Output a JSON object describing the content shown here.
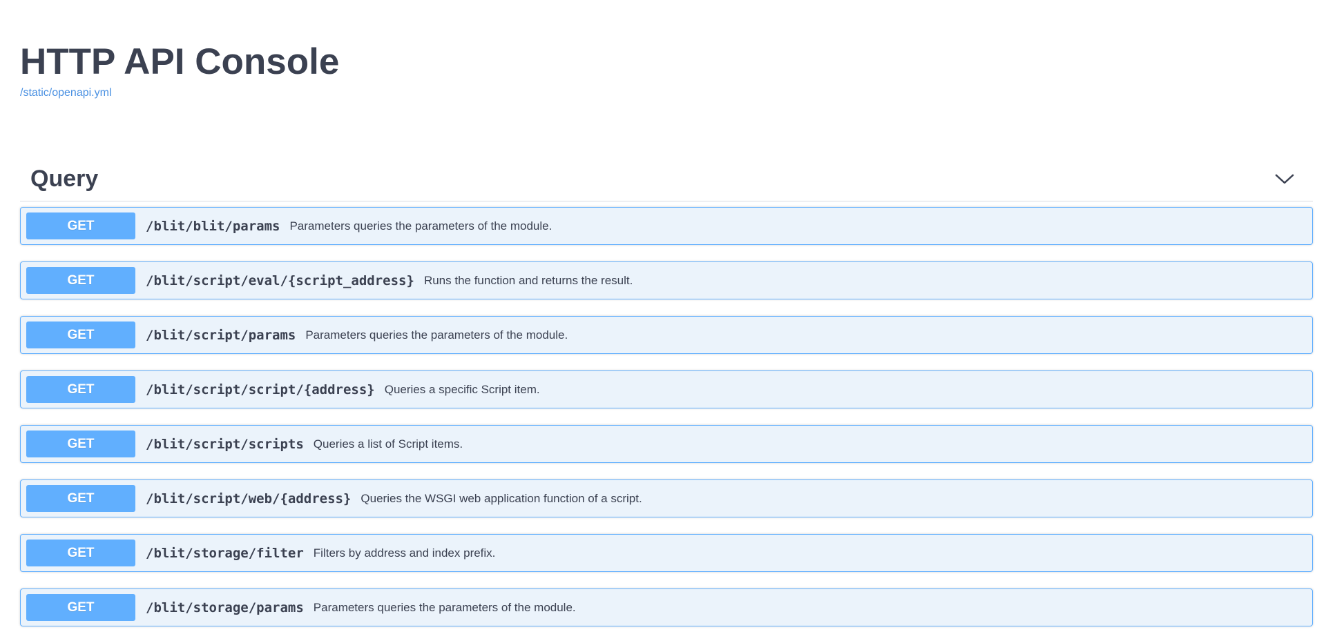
{
  "header": {
    "title": "HTTP API Console",
    "spec_link": "/static/openapi.yml"
  },
  "section": {
    "title": "Query",
    "toggle_icon": "chevron-down-icon",
    "operations": [
      {
        "method": "GET",
        "path": "/blit/blit/params",
        "summary": "Parameters queries the parameters of the module."
      },
      {
        "method": "GET",
        "path": "/blit/script/eval/{script_address}",
        "summary": "Runs the function and returns the result."
      },
      {
        "method": "GET",
        "path": "/blit/script/params",
        "summary": "Parameters queries the parameters of the module."
      },
      {
        "method": "GET",
        "path": "/blit/script/script/{address}",
        "summary": "Queries a specific Script item."
      },
      {
        "method": "GET",
        "path": "/blit/script/scripts",
        "summary": "Queries a list of Script items."
      },
      {
        "method": "GET",
        "path": "/blit/script/web/{address}",
        "summary": "Queries the WSGI web application function of a script."
      },
      {
        "method": "GET",
        "path": "/blit/storage/filter",
        "summary": "Filters by address and index prefix."
      },
      {
        "method": "GET",
        "path": "/blit/storage/params",
        "summary": "Parameters queries the parameters of the module."
      }
    ]
  },
  "colors": {
    "get_method": "#61affe",
    "get_background": "#ebf3fb",
    "text": "#3b4151",
    "link": "#4990e2"
  }
}
